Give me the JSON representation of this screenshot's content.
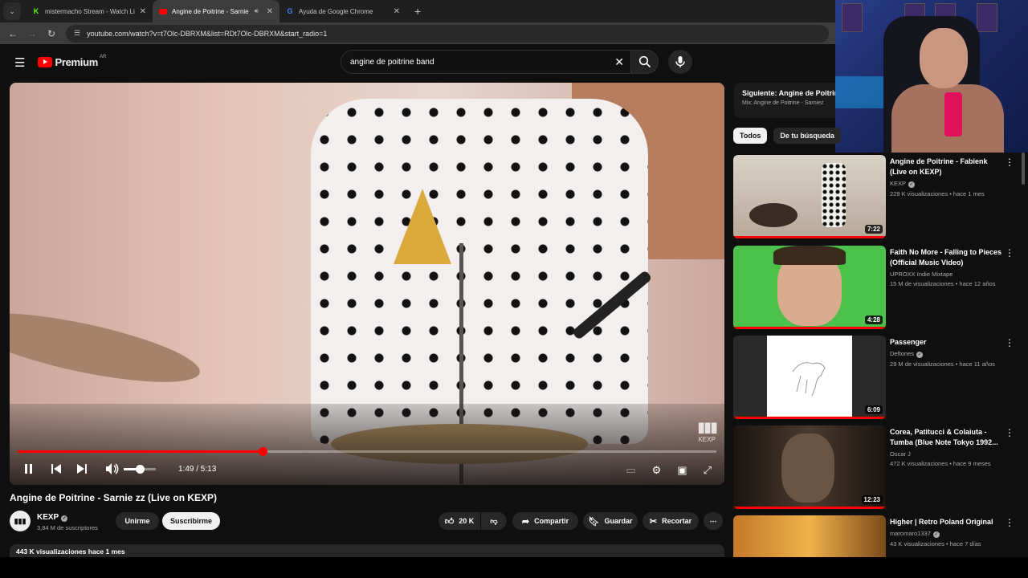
{
  "browser": {
    "tabs": [
      {
        "title": "mistermacho Stream - Watch Li",
        "active": false
      },
      {
        "title": "Angine de Poitrine - Sarnie",
        "active": true
      },
      {
        "title": "Ayuda de Google Chrome",
        "active": false
      }
    ],
    "url": "youtube.com/watch?v=t7Olc-DBRXM&list=RDt7Olc-DBRXM&start_radio=1"
  },
  "youtube": {
    "logo_text": "Premium",
    "region": "AR",
    "search_query": "angine de poitrine band"
  },
  "player": {
    "current_time": "1:49",
    "duration": "5:13",
    "time_display": "1:49 / 5:13",
    "progress_fraction": 0.35,
    "volume_fraction": 0.5,
    "watermark": "KEXP"
  },
  "video": {
    "title": "Angine de Poitrine - Sarnie zz (Live on KEXP)",
    "channel": "KEXP",
    "subscribers": "3,84 M de suscriptores",
    "join_label": "Unirme",
    "subscribe_label": "Suscribirme",
    "likes": "20 K",
    "share_label": "Compartir",
    "save_label": "Guardar",
    "clip_label": "Recortar",
    "views_line": "443 K visualizaciones  hace 1 mes"
  },
  "sidebar": {
    "up_next_title": "Siguiente: Angine de Poitrin",
    "up_next_mix": "Mix: Angine de Poitrine - Sarniez",
    "chips": [
      "Todos",
      "De tu búsqueda"
    ],
    "recommendations": [
      {
        "title": "Angine de Poitrine - Fabienk (Live on KEXP)",
        "channel": "KEXP",
        "verified": true,
        "meta": "229 K visualizaciones • hace 1 mes",
        "duration": "7:22",
        "color": "#d8d2c8"
      },
      {
        "title": "Faith No More - Falling to Pieces (Official Music Video)",
        "channel": "UPROXX Indie Mixtape",
        "verified": false,
        "meta": "15 M de visualizaciones • hace 12 años",
        "duration": "4:28",
        "color": "#49c24a"
      },
      {
        "title": "Passenger",
        "channel": "Deftones",
        "verified": true,
        "meta": "29 M de visualizaciones • hace 11 años",
        "duration": "6:09",
        "color": "#2e2e2e"
      },
      {
        "title": "Corea, Patitucci & Colaiuta - Tumba (Blue Note Tokyo 1992...",
        "channel": "Oscar J",
        "verified": false,
        "meta": "472 K visualizaciones • hace 9 meses",
        "duration": "12:23",
        "color": "#3a2b22"
      },
      {
        "title": "Higher | Retro Poland Original",
        "channel": "maromaro1337",
        "verified": true,
        "meta": "43 K visualizaciones • hace 7 días",
        "duration": "",
        "color": "#8a5a22"
      }
    ]
  },
  "colors": {
    "accent": "#ff0000",
    "background": "#0f0f0f"
  }
}
